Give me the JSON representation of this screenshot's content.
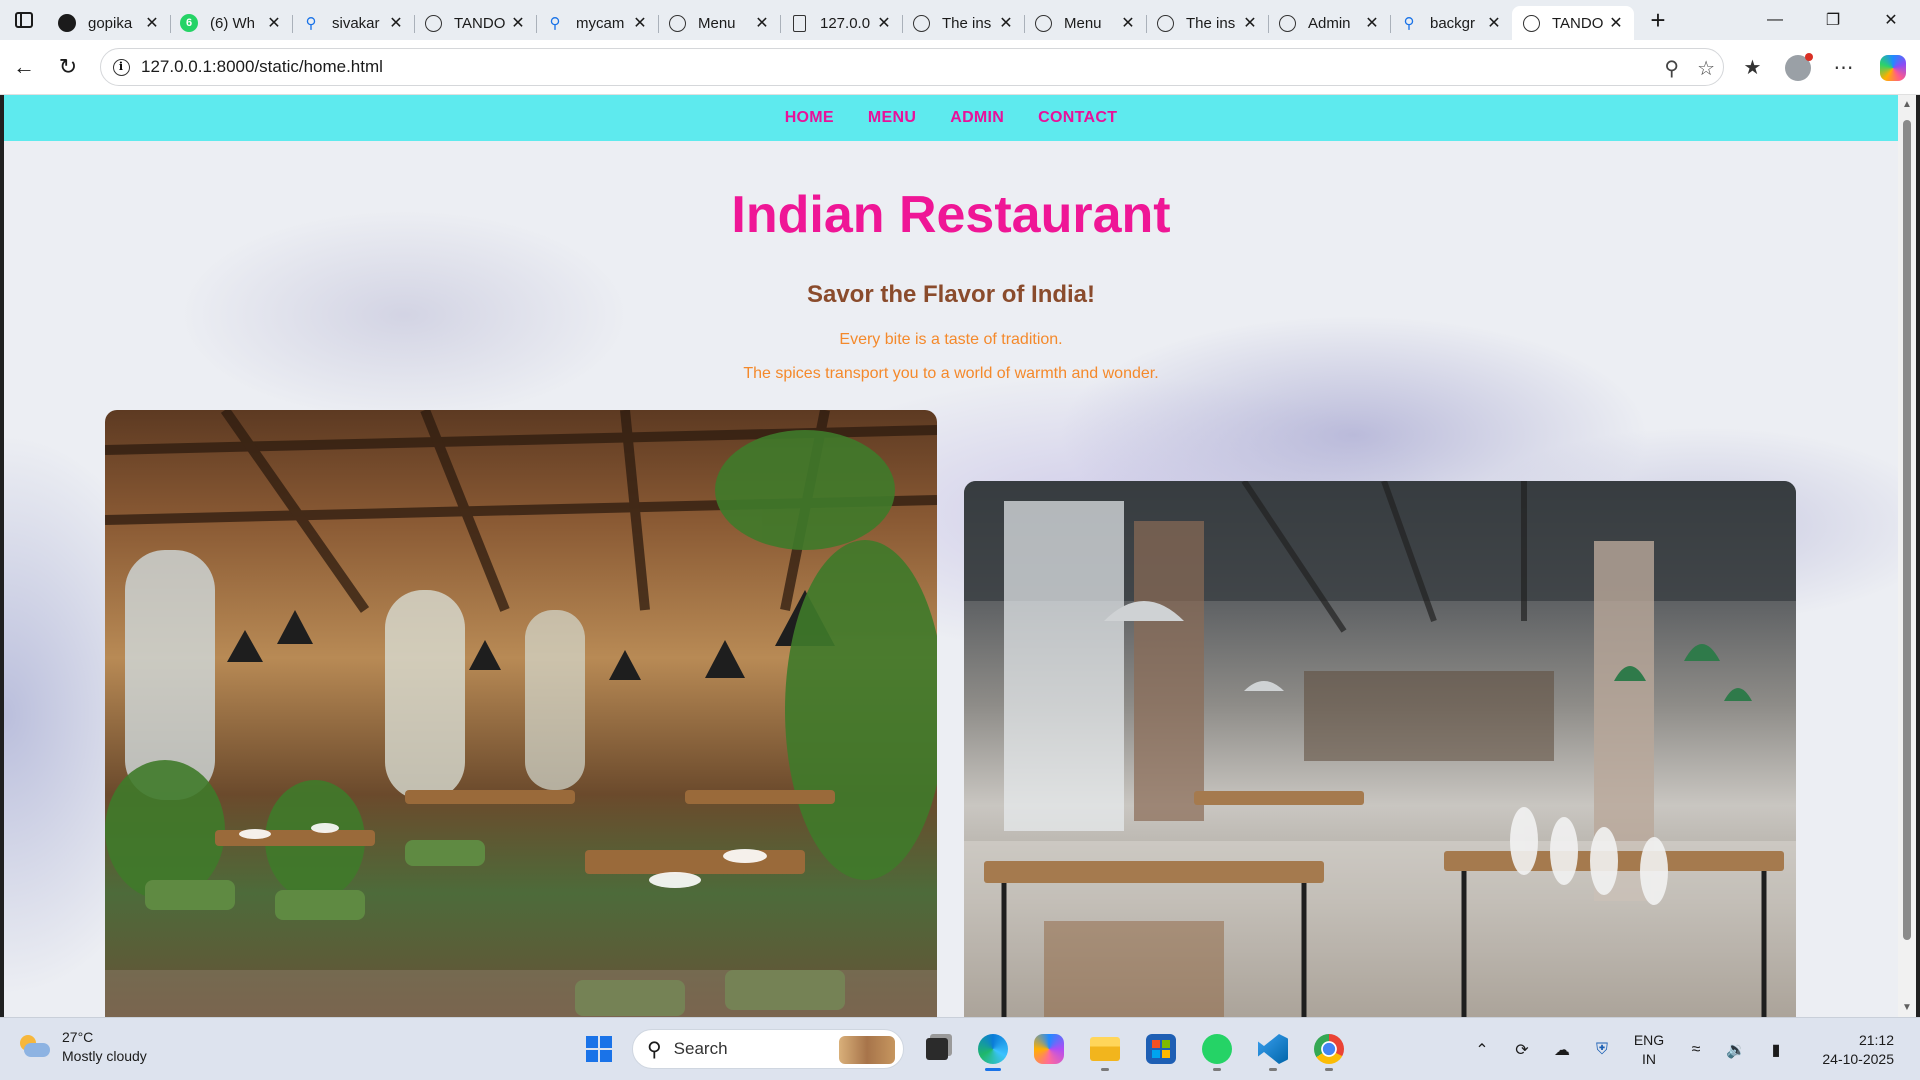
{
  "browser": {
    "tabs": [
      {
        "title": "gopika",
        "icon": "github-icon",
        "active": false
      },
      {
        "title": "(6) Wh",
        "icon": "whatsapp-icon",
        "badge": "6",
        "active": false
      },
      {
        "title": "sivakar",
        "icon": "search-icon",
        "active": false
      },
      {
        "title": "TANDO",
        "icon": "globe-icon",
        "active": false
      },
      {
        "title": "mycam",
        "icon": "search-icon",
        "active": false
      },
      {
        "title": "Menu",
        "icon": "globe-icon",
        "active": false
      },
      {
        "title": "127.0.0",
        "icon": "file-icon",
        "active": false
      },
      {
        "title": "The ins",
        "icon": "globe-icon",
        "active": false
      },
      {
        "title": "Menu",
        "icon": "globe-icon",
        "active": false
      },
      {
        "title": "The ins",
        "icon": "globe-icon",
        "active": false
      },
      {
        "title": "Admin",
        "icon": "globe-icon",
        "active": false
      },
      {
        "title": "backgr",
        "icon": "search-icon",
        "active": false
      },
      {
        "title": "TANDO",
        "icon": "globe-icon",
        "active": true
      }
    ],
    "url": "127.0.0.1:8000/static/home.html"
  },
  "site": {
    "nav": [
      "HOME",
      "MENU",
      "ADMIN",
      "CONTACT"
    ],
    "title": "Indian Restaurant",
    "tagline": "Savor the Flavor of India!",
    "line1": "Every bite is a taste of tradition.",
    "line2": "The spices transport you to a world of warmth and wonder.",
    "colors": {
      "nav_bg": "#5eeaee",
      "nav_link": "#e8119a",
      "title": "#ef1696",
      "tagline": "#8a4b2c",
      "body_text": "#f4892b"
    }
  },
  "taskbar": {
    "weather_temp": "27°C",
    "weather_desc": "Mostly cloudy",
    "search_placeholder": "Search",
    "lang_top": "ENG",
    "lang_bottom": "IN",
    "time": "21:12",
    "date": "24-10-2025",
    "apps": [
      "task-view-icon",
      "edge-icon",
      "copilot-icon",
      "file-explorer-icon",
      "store-icon",
      "whatsapp-icon",
      "vscode-icon",
      "chrome-icon"
    ]
  }
}
